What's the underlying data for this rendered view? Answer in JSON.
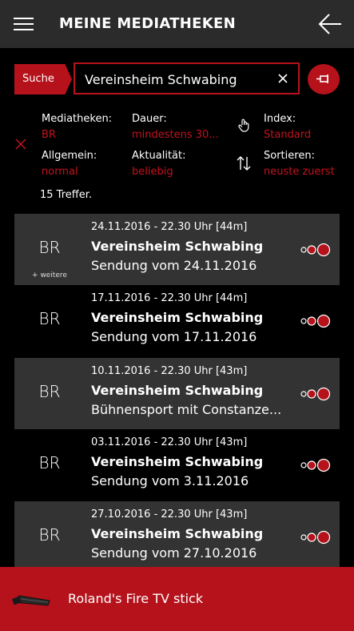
{
  "header": {
    "title": "MEINE MEDIATHEKEN"
  },
  "search": {
    "tag_label": "Suche",
    "query": "Vereinsheim Schwabing"
  },
  "filters": {
    "mediatheken": {
      "label": "Mediatheken:",
      "value": "BR"
    },
    "dauer": {
      "label": "Dauer:",
      "value": "mindestens 30..."
    },
    "index": {
      "label": "Index:",
      "value": "Standard"
    },
    "allgemein": {
      "label": "Allgemein:",
      "value": "normal"
    },
    "aktualitaet": {
      "label": "Aktualität:",
      "value": "beliebig"
    },
    "sortieren": {
      "label": "Sortieren:",
      "value": "neuste zuerst"
    }
  },
  "results": {
    "count_text": "15 Treffer.",
    "items": [
      {
        "channel": "BR",
        "more": "+ weitere",
        "date": "24.11.2016 - 22.30 Uhr [44m]",
        "title": "Vereinsheim Schwabing",
        "subtitle": "Sendung vom 24.11.2016"
      },
      {
        "channel": "BR",
        "more": "",
        "date": "17.11.2016 - 22.30 Uhr [44m]",
        "title": "Vereinsheim Schwabing",
        "subtitle": "Sendung vom 17.11.2016"
      },
      {
        "channel": "BR",
        "more": "",
        "date": "10.11.2016 - 22.30 Uhr [43m]",
        "title": "Vereinsheim Schwabing",
        "subtitle": "Bühnensport mit Constanze..."
      },
      {
        "channel": "BR",
        "more": "",
        "date": "03.11.2016 - 22.30 Uhr [43m]",
        "title": "Vereinsheim Schwabing",
        "subtitle": "Sendung vom 3.11.2016"
      },
      {
        "channel": "BR",
        "more": "",
        "date": "27.10.2016 - 22.30 Uhr [43m]",
        "title": "Vereinsheim Schwabing",
        "subtitle": "Sendung vom 27.10.2016"
      }
    ]
  },
  "device": {
    "name": "Roland's Fire TV stick"
  },
  "icons": {
    "menu": "hamburger-icon",
    "back": "arrow-left-icon",
    "clear": "close-icon",
    "pin": "pin-icon",
    "reset_filters": "close-icon",
    "index": "hand-pointer-icon",
    "sort": "sort-arrows-icon",
    "row_action": "quality-dots-icon",
    "device": "fire-tv-stick-icon"
  },
  "colors": {
    "accent": "#b5121b",
    "filter_value": "#c3121e",
    "header_bg": "#2b2b2b",
    "row_alt_bg": "#333333",
    "background": "#000000"
  }
}
